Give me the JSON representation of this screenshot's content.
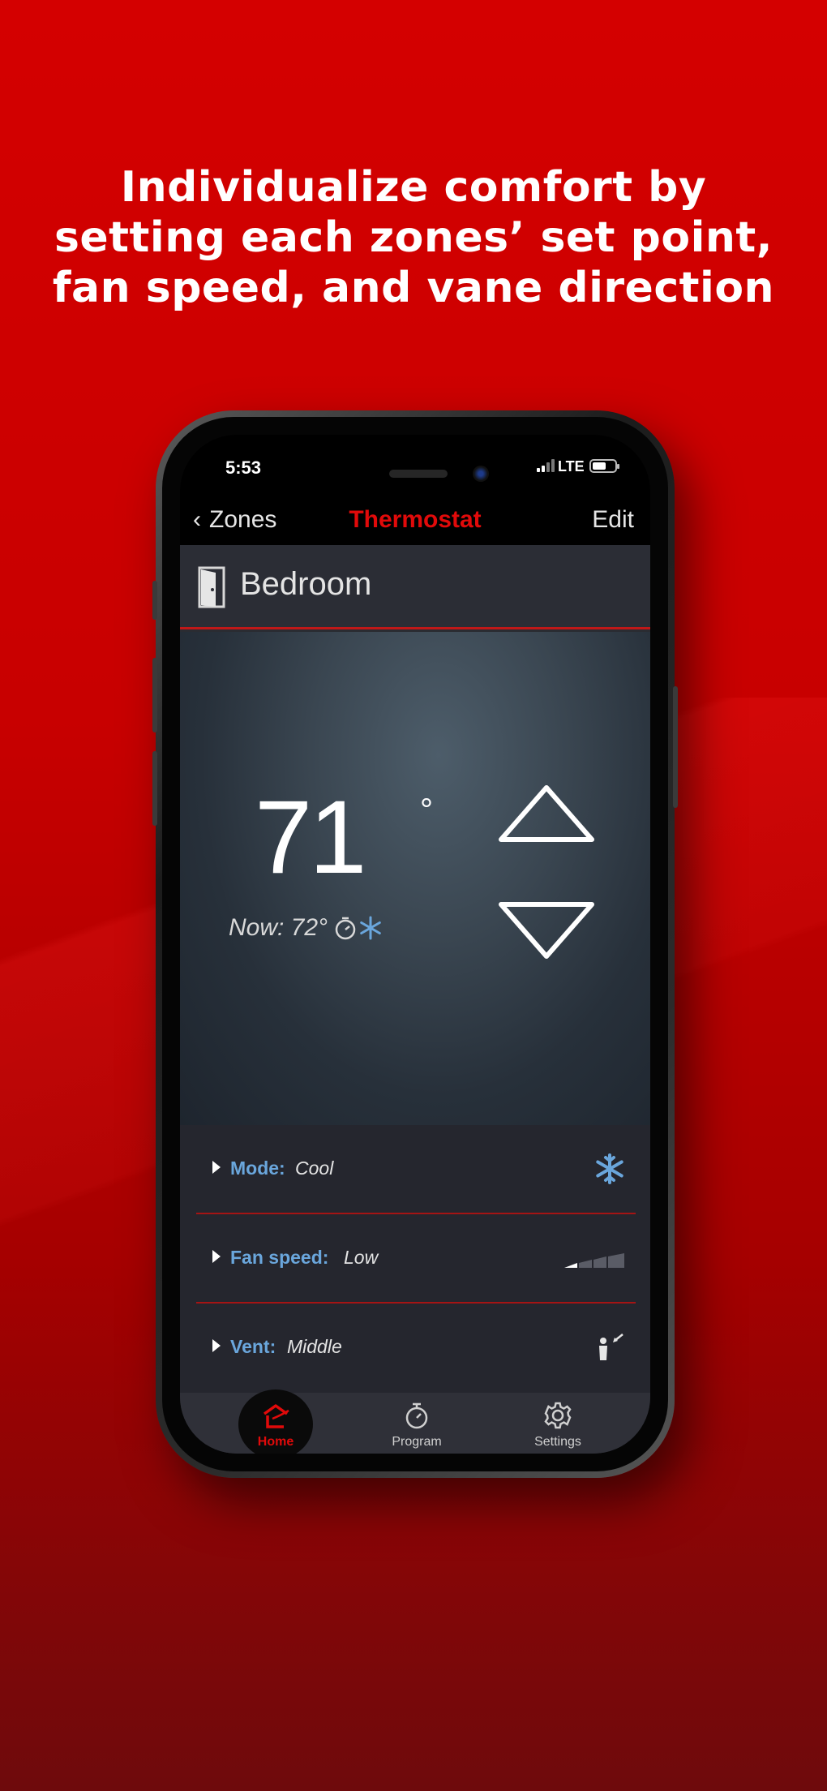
{
  "headline": "Individualize comfort by\nsetting each zones’ set point,\nfan speed, and vane direction",
  "status_bar": {
    "time": "5:53",
    "network": "LTE"
  },
  "nav": {
    "back_label": "Zones",
    "title": "Thermostat",
    "edit_label": "Edit"
  },
  "zone": {
    "name": "Bedroom"
  },
  "thermostat": {
    "setpoint": "71",
    "degree_symbol": "°",
    "now_label": "Now: 72°"
  },
  "settings": [
    {
      "label": "Mode:",
      "value": "Cool",
      "icon": "snowflake-icon"
    },
    {
      "label": "Fan speed:",
      "value": "Low",
      "icon": "fan-speed-bars-icon"
    },
    {
      "label": "Vent:",
      "value": "Middle",
      "icon": "vane-direction-icon"
    }
  ],
  "tabs": [
    {
      "label": "Home",
      "icon": "home-icon",
      "active": true
    },
    {
      "label": "Program",
      "icon": "timer-icon",
      "active": false
    },
    {
      "label": "Settings",
      "icon": "gear-icon",
      "active": false
    }
  ],
  "colors": {
    "background_red": "#d40000",
    "accent_red": "#e10a0a",
    "label_blue": "#6aa6dc",
    "snowflake_blue": "#6aa6dc"
  }
}
